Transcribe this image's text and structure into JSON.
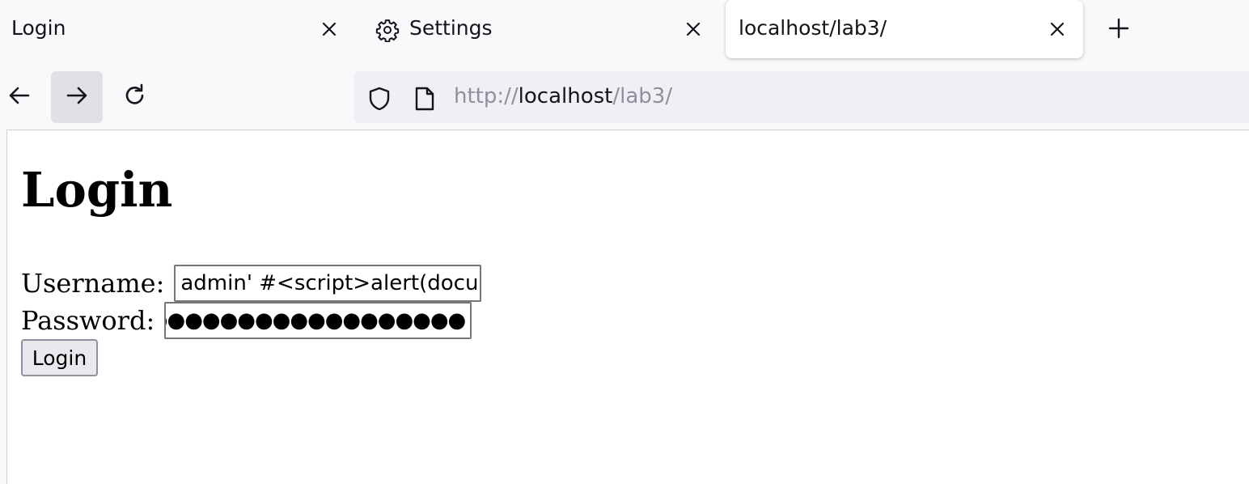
{
  "tabs": [
    {
      "label": "Login",
      "active": false,
      "icon": null
    },
    {
      "label": "Settings",
      "active": false,
      "icon": "gear-icon"
    },
    {
      "label": "localhost/lab3/",
      "active": true,
      "icon": null
    }
  ],
  "toolbar": {
    "new_tab_icon": "plus-icon",
    "back_icon": "arrow-left-icon",
    "forward_icon": "arrow-right-icon",
    "reload_icon": "reload-icon"
  },
  "urlbar": {
    "scheme": "http://",
    "host": "localhost",
    "path": "/lab3/",
    "security_icon": "shield-icon",
    "page_icon": "page-icon"
  },
  "page": {
    "title": "Login",
    "username_label": "Username:",
    "username_value": "admin' #<script>alert(docu",
    "password_label": "Password:",
    "password_mask": "●●●●●●●●●●●●●●●●●●",
    "login_button": "Login"
  },
  "colors": {
    "chrome_bg": "#f9f9fb",
    "urlbar_bg": "#f0f0f4",
    "active_tab_bg": "#ffffff",
    "text_primary": "#15141a",
    "text_dim": "#8f8f9d"
  }
}
